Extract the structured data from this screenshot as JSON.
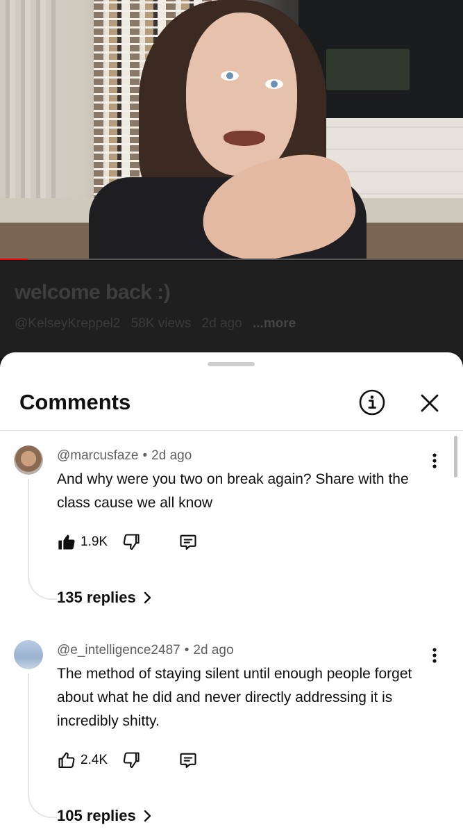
{
  "video": {
    "title": "welcome back :)",
    "channel": "@KelseyKreppel2",
    "views": "58K views",
    "age": "2d ago",
    "more_label": "...more",
    "progress_fraction": 0.06
  },
  "comments_sheet": {
    "title": "Comments",
    "info_icon": "info-icon",
    "close_icon": "close-icon"
  },
  "comments": [
    {
      "author": "@marcusfaze",
      "age": "2d ago",
      "text": "And why were you two on break again? Share with the class cause we all know",
      "likes": "1.9K",
      "liked": true,
      "replies_label": "135 replies"
    },
    {
      "author": "@e_intelligence2487",
      "age": "2d ago",
      "text": "The method of staying silent until enough people forget about what he did and never directly addressing it is incredibly shitty.",
      "likes": "2.4K",
      "liked": false,
      "replies_label": "105 replies"
    }
  ],
  "colors": {
    "progress": "#ff0000",
    "sheet_bg": "#ffffff",
    "text_primary": "#0f0f0f",
    "text_secondary": "#606060"
  }
}
